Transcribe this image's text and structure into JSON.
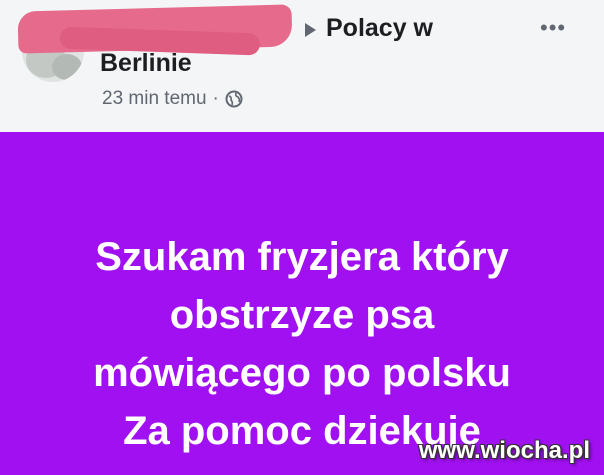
{
  "post": {
    "group_name": "Polacy w",
    "group_name_line2": "Berlinie",
    "time": "23 min temu",
    "separator": "·",
    "more_icon": "more-options-icon",
    "visibility_icon": "globe-icon",
    "text_lines": [
      "Szukam fryzjera który",
      "obstrzyze psa",
      "mówiącego po polsku",
      "Za pomoc dziekuje"
    ],
    "background_color": "#a010f0"
  },
  "watermark": "www.wiocha.pl"
}
